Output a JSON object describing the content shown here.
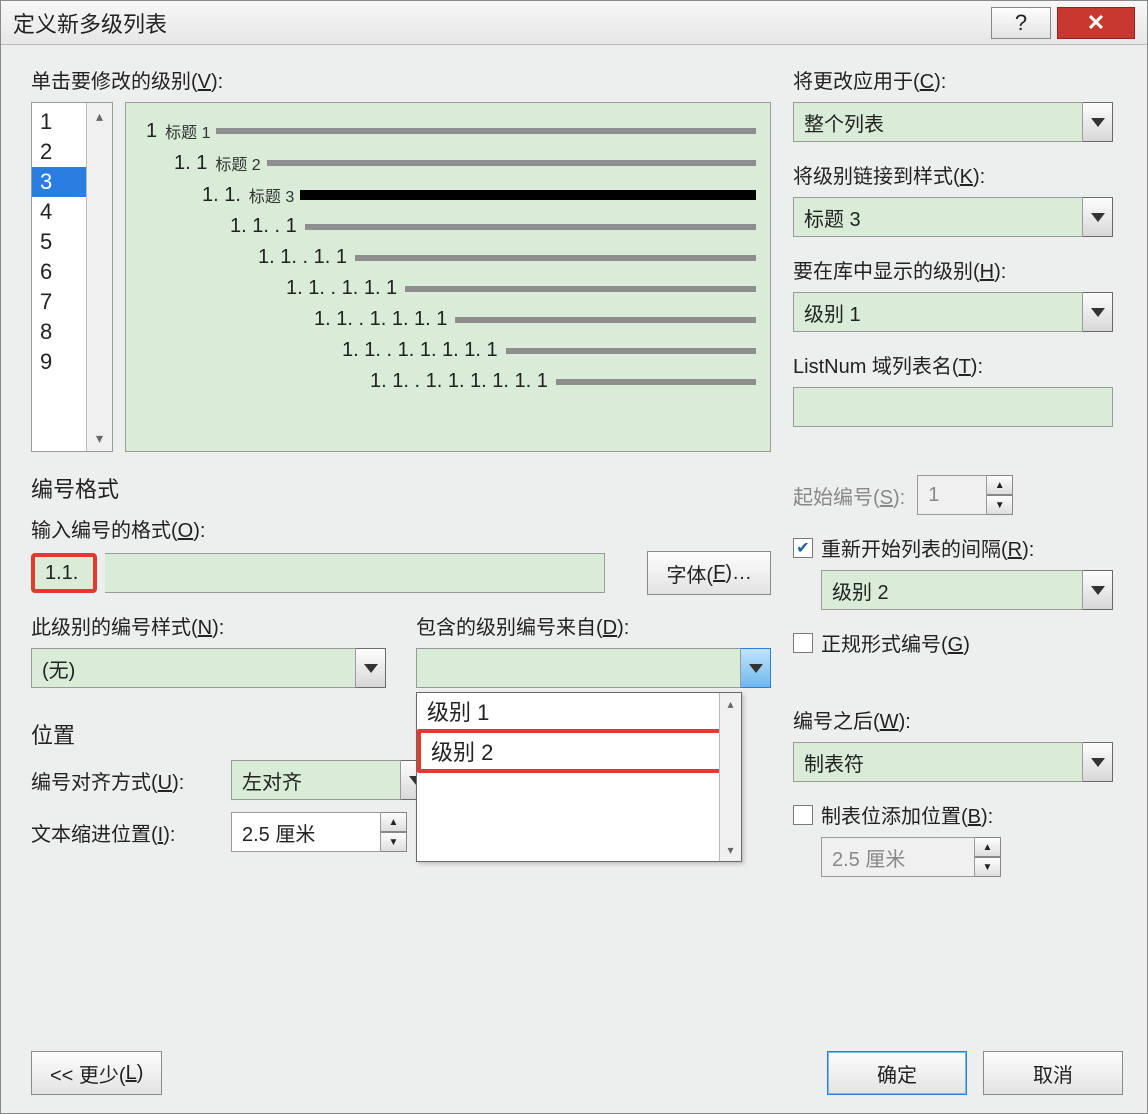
{
  "title": "定义新多级列表",
  "titlebar": {
    "help": "?",
    "close": "✕"
  },
  "labels": {
    "click_level": "单击要修改的级别(",
    "click_level_u": "V",
    "apply_to": "将更改应用于(",
    "apply_to_u": "C",
    "link_style": "将级别链接到样式(",
    "link_style_u": "K",
    "show_in_gallery": "要在库中显示的级别(",
    "show_in_gallery_u": "H",
    "listnum": "ListNum 域列表名(",
    "listnum_u": "T",
    "number_format_section": "编号格式",
    "enter_format": "输入编号的格式(",
    "enter_format_u": "O",
    "font_btn": "字体(",
    "font_btn_u": "F",
    "number_style": "此级别的编号样式(",
    "number_style_u": "N",
    "include_from": "包含的级别编号来自(",
    "include_from_u": "D",
    "position_section": "位置",
    "align": "编号对齐方式(",
    "align_u": "U",
    "text_indent": "文本缩进位置(",
    "text_indent_u": "I",
    "start_at": "起始编号(",
    "start_at_u": "S",
    "restart": "重新开始列表的间隔(",
    "restart_u": "R",
    "legal": "正规形式编号(",
    "legal_u": "G",
    "follow": "编号之后(",
    "follow_u": "W",
    "tab_add": "制表位添加位置(",
    "tab_add_u": "B",
    "less": "<< 更少(",
    "less_u": "L",
    "ok": "确定",
    "cancel": "取消",
    "close_paren": "):",
    "close_paren2": ")…",
    "close_paren3": ")"
  },
  "levels": [
    "1",
    "2",
    "3",
    "4",
    "5",
    "6",
    "7",
    "8",
    "9"
  ],
  "selected_level_index": 2,
  "preview": [
    {
      "indent": 0,
      "num": "1",
      "sub": "标题 1",
      "bold": false
    },
    {
      "indent": 1,
      "num": "1. 1",
      "sub": "标题 2",
      "bold": false
    },
    {
      "indent": 2,
      "num": "1. 1.",
      "sub": "标题 3",
      "bold": true
    },
    {
      "indent": 3,
      "num": "1. 1. . 1",
      "sub": "",
      "bold": false
    },
    {
      "indent": 4,
      "num": "1. 1. . 1. 1",
      "sub": "",
      "bold": false
    },
    {
      "indent": 5,
      "num": "1. 1. . 1. 1. 1",
      "sub": "",
      "bold": false
    },
    {
      "indent": 6,
      "num": "1. 1. . 1. 1. 1. 1",
      "sub": "",
      "bold": false
    },
    {
      "indent": 7,
      "num": "1. 1. . 1. 1. 1. 1. 1",
      "sub": "",
      "bold": false
    },
    {
      "indent": 8,
      "num": "1. 1. . 1. 1. 1. 1. 1. 1",
      "sub": "",
      "bold": false
    }
  ],
  "values": {
    "apply_to": "整个列表",
    "link_style": "标题 3",
    "show_in_gallery": "级别 1",
    "listnum": "",
    "format_input": "1.1.",
    "number_style": "(无)",
    "include_from": "",
    "include_from_options": [
      "级别 1",
      "级别 2"
    ],
    "include_from_selected": 1,
    "align": "左对齐",
    "text_indent": "2.5 厘米",
    "start_at": "1",
    "restart_checked": true,
    "restart_level": "级别 2",
    "legal_checked": false,
    "follow": "制表符",
    "tab_add_checked": false,
    "tab_add_val": "2.5 厘米"
  }
}
